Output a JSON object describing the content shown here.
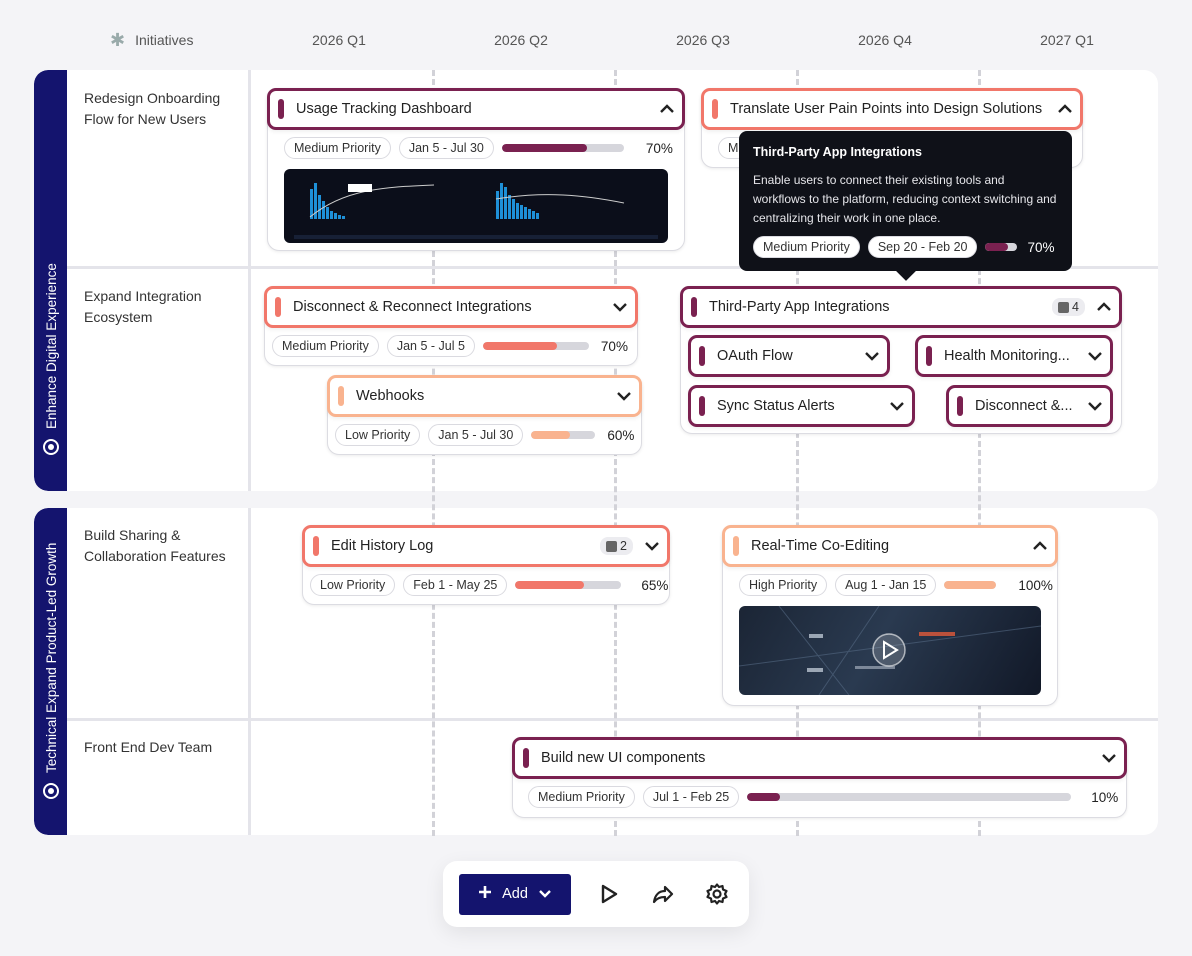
{
  "header": {
    "initiatives_label": "Initiatives",
    "quarters": [
      "2026 Q1",
      "2026 Q2",
      "2026 Q3",
      "2026 Q4",
      "2027 Q1"
    ]
  },
  "sections": [
    {
      "label": "Enhance Digital Experience",
      "initiatives": [
        "Redesign Onboarding Flow for New Users",
        "Expand Integration Ecosystem"
      ]
    },
    {
      "label": "Technical Expand Product-Led Growth",
      "initiatives": [
        "Build Sharing & Collaboration Features",
        "Front End Dev Team"
      ]
    }
  ],
  "cards": {
    "usage": {
      "title": "Usage Tracking Dashboard",
      "priority": "Medium Priority",
      "dates": "Jan 5 - Jul 30",
      "progress": 0.7,
      "pct": "70%"
    },
    "translate": {
      "title": "Translate User Pain Points into Design Solutions",
      "priority": "M"
    },
    "disconnect": {
      "title": "Disconnect & Reconnect Integrations",
      "priority": "Medium Priority",
      "dates": "Jan 5 - Jul 5",
      "progress": 0.7,
      "pct": "70%"
    },
    "webhooks": {
      "title": "Webhooks",
      "priority": "Low Priority",
      "dates": "Jan 5 - Jul 30",
      "progress": 0.6,
      "pct": "60%"
    },
    "third_party": {
      "title": "Third-Party App Integrations",
      "count": "4",
      "children": [
        "OAuth Flow",
        "Health Monitoring...",
        "Sync Status Alerts",
        "Disconnect &..."
      ]
    },
    "edit_history": {
      "title": "Edit History Log",
      "count": "2",
      "priority": "Low Priority",
      "dates": "Feb 1 - May 25",
      "progress": 0.65,
      "pct": "65%"
    },
    "realtime": {
      "title": "Real-Time Co-Editing",
      "priority": "High Priority",
      "dates": "Aug 1 - Jan 15",
      "progress": 1.0,
      "pct": "100%"
    },
    "build_ui": {
      "title": "Build new UI components",
      "priority": "Medium Priority",
      "dates": "Jul 1 - Feb 25",
      "progress": 0.1,
      "pct": "10%"
    }
  },
  "tooltip": {
    "title": "Third-Party App Integrations",
    "description": "Enable users to connect their existing tools and workflows to the platform, reducing context switching and centralizing their work in one place.",
    "priority": "Medium Priority",
    "dates": "Sep 20 - Feb 20",
    "progress": 0.7,
    "pct": "70%"
  },
  "toolbar": {
    "add_label": "Add"
  },
  "colors": {
    "navy": "#14146e",
    "plum": "#7a2150",
    "coral": "#f1776a",
    "peach": "#f9b38f"
  }
}
